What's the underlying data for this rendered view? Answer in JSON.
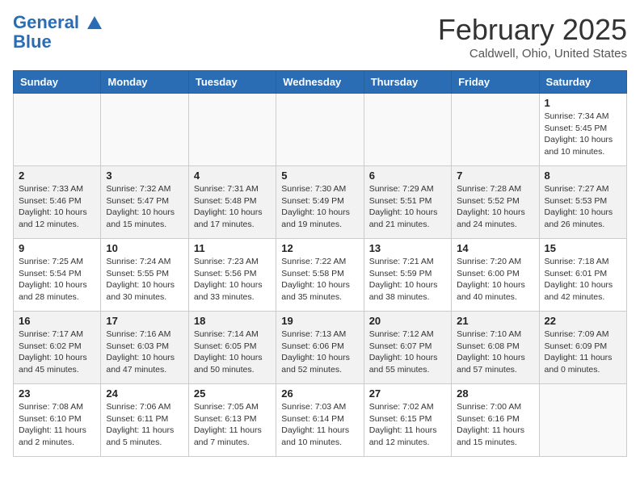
{
  "logo": {
    "line1": "General",
    "line2": "Blue"
  },
  "title": "February 2025",
  "subtitle": "Caldwell, Ohio, United States",
  "headers": [
    "Sunday",
    "Monday",
    "Tuesday",
    "Wednesday",
    "Thursday",
    "Friday",
    "Saturday"
  ],
  "weeks": [
    [
      {
        "day": "",
        "info": ""
      },
      {
        "day": "",
        "info": ""
      },
      {
        "day": "",
        "info": ""
      },
      {
        "day": "",
        "info": ""
      },
      {
        "day": "",
        "info": ""
      },
      {
        "day": "",
        "info": ""
      },
      {
        "day": "1",
        "info": "Sunrise: 7:34 AM\nSunset: 5:45 PM\nDaylight: 10 hours and 10 minutes."
      }
    ],
    [
      {
        "day": "2",
        "info": "Sunrise: 7:33 AM\nSunset: 5:46 PM\nDaylight: 10 hours and 12 minutes."
      },
      {
        "day": "3",
        "info": "Sunrise: 7:32 AM\nSunset: 5:47 PM\nDaylight: 10 hours and 15 minutes."
      },
      {
        "day": "4",
        "info": "Sunrise: 7:31 AM\nSunset: 5:48 PM\nDaylight: 10 hours and 17 minutes."
      },
      {
        "day": "5",
        "info": "Sunrise: 7:30 AM\nSunset: 5:49 PM\nDaylight: 10 hours and 19 minutes."
      },
      {
        "day": "6",
        "info": "Sunrise: 7:29 AM\nSunset: 5:51 PM\nDaylight: 10 hours and 21 minutes."
      },
      {
        "day": "7",
        "info": "Sunrise: 7:28 AM\nSunset: 5:52 PM\nDaylight: 10 hours and 24 minutes."
      },
      {
        "day": "8",
        "info": "Sunrise: 7:27 AM\nSunset: 5:53 PM\nDaylight: 10 hours and 26 minutes."
      }
    ],
    [
      {
        "day": "9",
        "info": "Sunrise: 7:25 AM\nSunset: 5:54 PM\nDaylight: 10 hours and 28 minutes."
      },
      {
        "day": "10",
        "info": "Sunrise: 7:24 AM\nSunset: 5:55 PM\nDaylight: 10 hours and 30 minutes."
      },
      {
        "day": "11",
        "info": "Sunrise: 7:23 AM\nSunset: 5:56 PM\nDaylight: 10 hours and 33 minutes."
      },
      {
        "day": "12",
        "info": "Sunrise: 7:22 AM\nSunset: 5:58 PM\nDaylight: 10 hours and 35 minutes."
      },
      {
        "day": "13",
        "info": "Sunrise: 7:21 AM\nSunset: 5:59 PM\nDaylight: 10 hours and 38 minutes."
      },
      {
        "day": "14",
        "info": "Sunrise: 7:20 AM\nSunset: 6:00 PM\nDaylight: 10 hours and 40 minutes."
      },
      {
        "day": "15",
        "info": "Sunrise: 7:18 AM\nSunset: 6:01 PM\nDaylight: 10 hours and 42 minutes."
      }
    ],
    [
      {
        "day": "16",
        "info": "Sunrise: 7:17 AM\nSunset: 6:02 PM\nDaylight: 10 hours and 45 minutes."
      },
      {
        "day": "17",
        "info": "Sunrise: 7:16 AM\nSunset: 6:03 PM\nDaylight: 10 hours and 47 minutes."
      },
      {
        "day": "18",
        "info": "Sunrise: 7:14 AM\nSunset: 6:05 PM\nDaylight: 10 hours and 50 minutes."
      },
      {
        "day": "19",
        "info": "Sunrise: 7:13 AM\nSunset: 6:06 PM\nDaylight: 10 hours and 52 minutes."
      },
      {
        "day": "20",
        "info": "Sunrise: 7:12 AM\nSunset: 6:07 PM\nDaylight: 10 hours and 55 minutes."
      },
      {
        "day": "21",
        "info": "Sunrise: 7:10 AM\nSunset: 6:08 PM\nDaylight: 10 hours and 57 minutes."
      },
      {
        "day": "22",
        "info": "Sunrise: 7:09 AM\nSunset: 6:09 PM\nDaylight: 11 hours and 0 minutes."
      }
    ],
    [
      {
        "day": "23",
        "info": "Sunrise: 7:08 AM\nSunset: 6:10 PM\nDaylight: 11 hours and 2 minutes."
      },
      {
        "day": "24",
        "info": "Sunrise: 7:06 AM\nSunset: 6:11 PM\nDaylight: 11 hours and 5 minutes."
      },
      {
        "day": "25",
        "info": "Sunrise: 7:05 AM\nSunset: 6:13 PM\nDaylight: 11 hours and 7 minutes."
      },
      {
        "day": "26",
        "info": "Sunrise: 7:03 AM\nSunset: 6:14 PM\nDaylight: 11 hours and 10 minutes."
      },
      {
        "day": "27",
        "info": "Sunrise: 7:02 AM\nSunset: 6:15 PM\nDaylight: 11 hours and 12 minutes."
      },
      {
        "day": "28",
        "info": "Sunrise: 7:00 AM\nSunset: 6:16 PM\nDaylight: 11 hours and 15 minutes."
      },
      {
        "day": "",
        "info": ""
      }
    ]
  ]
}
